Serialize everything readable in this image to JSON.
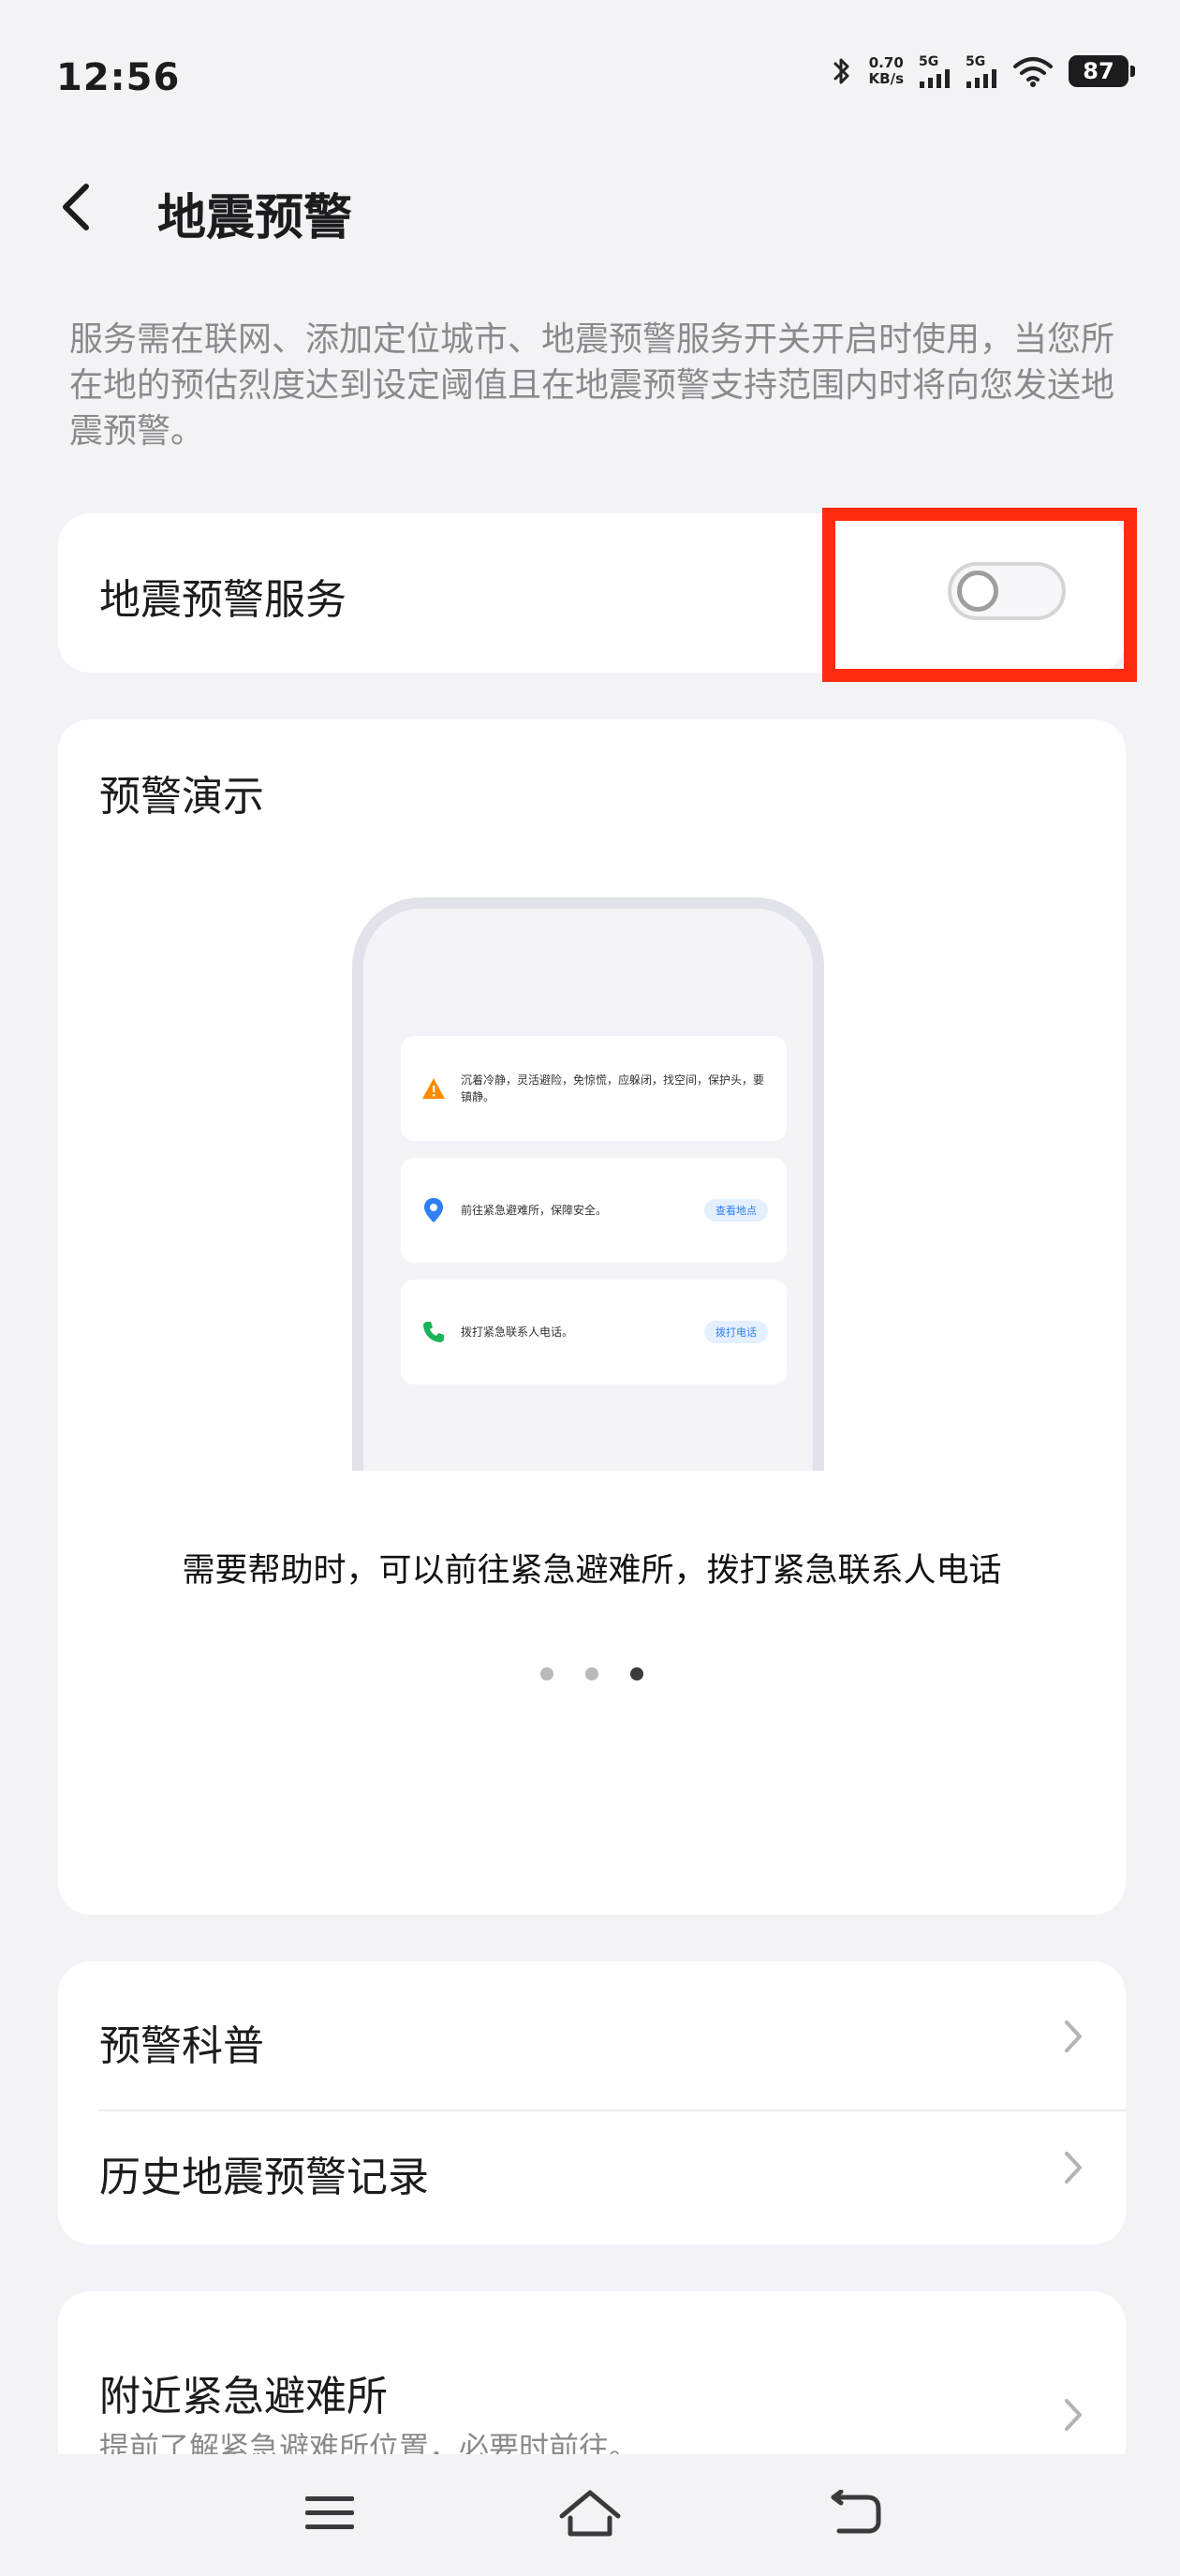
{
  "status_bar": {
    "time": "12:56",
    "net_speed_value": "0.70",
    "net_speed_unit": "KB/s",
    "signal1_label": "5G",
    "signal2_label": "5G",
    "battery": "87",
    "icons": [
      "bluetooth-icon",
      "signal-icon",
      "signal-icon",
      "wifi-icon",
      "battery-icon"
    ]
  },
  "header": {
    "title": "地震预警",
    "back_icon": "chevron-left-icon"
  },
  "description": "服务需在联网、添加定位城市、地震预警服务开关开启时使用，当您所在地的预估烈度达到设定阈值且在地震预警支持范围内时将向您发送地震预警。",
  "service": {
    "label": "地震预警服务",
    "toggle_on": false
  },
  "colors": {
    "highlight": "#fe2b0f",
    "accent_blue": "#2f7ff5",
    "warning_orange": "#ff8a00",
    "phone_green": "#1bb35a"
  },
  "demo": {
    "title": "预警演示",
    "notifications": [
      {
        "icon": "warning-icon",
        "text": "沉着冷静，灵活避险，免惊慌，应躲闭，找空间，保护头，要镇静。",
        "action": ""
      },
      {
        "icon": "location-icon",
        "text": "前往紧急避难所，保障安全。",
        "action": "查看地点"
      },
      {
        "icon": "phone-icon",
        "text": "拨打紧急联系人电话。",
        "action": "拨打电话"
      }
    ],
    "caption": "需要帮助时，可以前往紧急避难所，拨打紧急联系人电话",
    "carousel": {
      "total": 3,
      "active_index": 2
    }
  },
  "links": [
    {
      "label": "预警科普"
    },
    {
      "label": "历史地震预警记录"
    }
  ],
  "shelter": {
    "title": "附近紧急避难所",
    "subtitle": "提前了解紧急避难所位置，必要时前往。"
  },
  "nav": {
    "icons": [
      "menu-icon",
      "home-icon",
      "back-icon"
    ]
  }
}
